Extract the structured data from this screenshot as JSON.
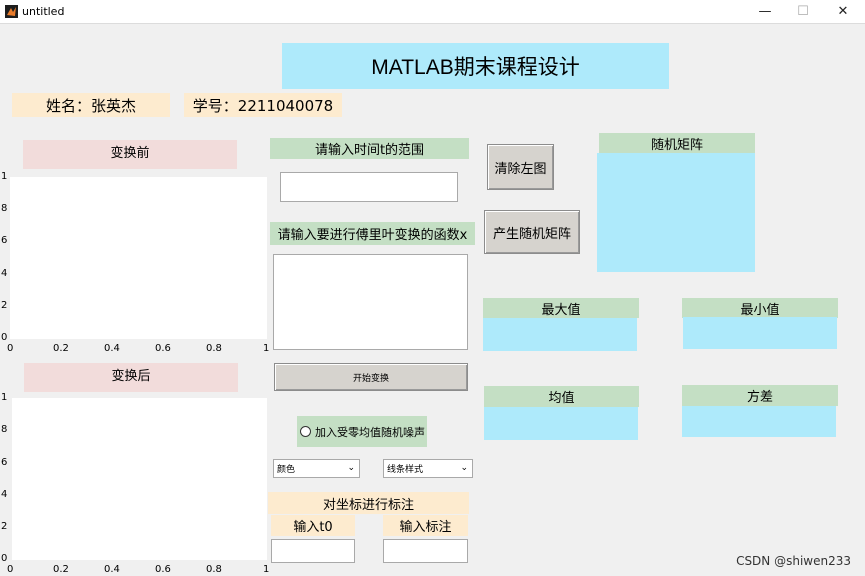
{
  "window": {
    "title": "untitled",
    "minimize": "—",
    "maximize": "☐",
    "close": "✕"
  },
  "header": {
    "title": "MATLAB期末课程设计"
  },
  "student": {
    "name": "姓名：张英杰",
    "id": "学号：2211040078"
  },
  "axes": {
    "before_label": "变换前",
    "after_label": "变换后",
    "ticks": [
      "0",
      "0.2",
      "0.4",
      "0.6",
      "0.8",
      "1"
    ],
    "y_ticks": [
      "1",
      "8",
      "6",
      "4",
      "2",
      "0"
    ]
  },
  "time_range": {
    "label": "请输入时间t的范围",
    "value": ""
  },
  "function_input": {
    "label": "请输入要进行傅里叶变换的函数x",
    "value": ""
  },
  "start_button": {
    "label": "开始变换"
  },
  "noise_radio": {
    "label": "加入受零均值随机噪声"
  },
  "color_select": {
    "value": "颜色"
  },
  "line_select": {
    "value": "线条样式"
  },
  "annotate": {
    "label": "对坐标进行标注",
    "t0_label": "输入t0",
    "mark_label": "输入标注",
    "t0_value": "",
    "mark_value": ""
  },
  "clear_button": {
    "label": "清除左图"
  },
  "random_button": {
    "label": "产生随机矩阵"
  },
  "random_matrix": {
    "label": "随机矩阵"
  },
  "stats": {
    "max_label": "最大值",
    "min_label": "最小值",
    "mean_label": "均值",
    "var_label": "方差"
  },
  "watermark": "CSDN @shiwen233"
}
